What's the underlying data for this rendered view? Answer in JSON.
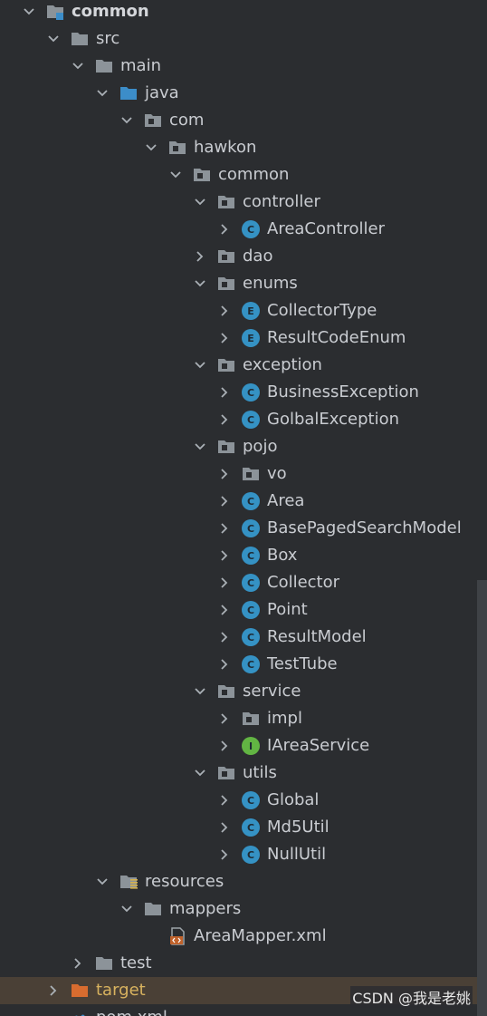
{
  "tree": [
    {
      "label": "common",
      "arrow": "down",
      "icon": "module-folder-icon",
      "bold": true
    },
    {
      "label": "src",
      "arrow": "down",
      "icon": "folder-icon"
    },
    {
      "label": "main",
      "arrow": "down",
      "icon": "folder-icon"
    },
    {
      "label": "java",
      "arrow": "down",
      "icon": "source-folder-icon"
    },
    {
      "label": "com",
      "arrow": "down",
      "icon": "package-icon"
    },
    {
      "label": "hawkon",
      "arrow": "down",
      "icon": "package-icon"
    },
    {
      "label": "common",
      "arrow": "down",
      "icon": "package-icon"
    },
    {
      "label": "controller",
      "arrow": "down",
      "icon": "package-icon"
    },
    {
      "label": "AreaController",
      "arrow": "right",
      "icon": "class-icon",
      "letter": "C"
    },
    {
      "label": "dao",
      "arrow": "right",
      "icon": "package-icon"
    },
    {
      "label": "enums",
      "arrow": "down",
      "icon": "package-icon"
    },
    {
      "label": "CollectorType",
      "arrow": "right",
      "icon": "enum-icon",
      "letter": "E"
    },
    {
      "label": "ResultCodeEnum",
      "arrow": "right",
      "icon": "enum-icon",
      "letter": "E"
    },
    {
      "label": "exception",
      "arrow": "down",
      "icon": "package-icon"
    },
    {
      "label": "BusinessException",
      "arrow": "right",
      "icon": "class-icon",
      "letter": "C"
    },
    {
      "label": "GolbalException",
      "arrow": "right",
      "icon": "class-icon",
      "letter": "C"
    },
    {
      "label": "pojo",
      "arrow": "down",
      "icon": "package-icon"
    },
    {
      "label": "vo",
      "arrow": "right",
      "icon": "package-icon"
    },
    {
      "label": "Area",
      "arrow": "right",
      "icon": "class-icon",
      "letter": "C"
    },
    {
      "label": "BasePagedSearchModel",
      "arrow": "right",
      "icon": "class-icon",
      "letter": "C"
    },
    {
      "label": "Box",
      "arrow": "right",
      "icon": "class-icon",
      "letter": "C"
    },
    {
      "label": "Collector",
      "arrow": "right",
      "icon": "class-icon",
      "letter": "C"
    },
    {
      "label": "Point",
      "arrow": "right",
      "icon": "class-icon",
      "letter": "C"
    },
    {
      "label": "ResultModel",
      "arrow": "right",
      "icon": "class-icon",
      "letter": "C"
    },
    {
      "label": "TestTube",
      "arrow": "right",
      "icon": "class-icon",
      "letter": "C"
    },
    {
      "label": "service",
      "arrow": "down",
      "icon": "package-icon"
    },
    {
      "label": "impl",
      "arrow": "right",
      "icon": "package-icon"
    },
    {
      "label": "IAreaService",
      "arrow": "right",
      "icon": "interface-icon",
      "letter": "I"
    },
    {
      "label": "utils",
      "arrow": "down",
      "icon": "package-icon"
    },
    {
      "label": "Global",
      "arrow": "right",
      "icon": "class-icon",
      "letter": "C"
    },
    {
      "label": "Md5Util",
      "arrow": "right",
      "icon": "class-icon",
      "letter": "C"
    },
    {
      "label": "NullUtil",
      "arrow": "right",
      "icon": "class-icon",
      "letter": "C"
    },
    {
      "label": "resources",
      "arrow": "down",
      "icon": "resources-folder-icon"
    },
    {
      "label": "mappers",
      "arrow": "down",
      "icon": "folder-icon"
    },
    {
      "label": "AreaMapper.xml",
      "arrow": "none",
      "icon": "xml-file-icon"
    },
    {
      "label": "test",
      "arrow": "right",
      "icon": "folder-icon"
    },
    {
      "label": "target",
      "arrow": "right",
      "icon": "excluded-folder-icon",
      "selected": true,
      "target": true
    },
    {
      "label": "pom.xml",
      "arrow": "none",
      "icon": "maven-file-icon"
    }
  ],
  "watermark": "CSDN @我是老姚",
  "colors": {
    "background": "#2b2d30",
    "text": "#c9ccd1",
    "class_icon": "#3592c4",
    "interface_icon": "#62b543",
    "folder": "#8c9399",
    "source_folder": "#3c8dc9",
    "excluded_folder": "#d86c2f",
    "selected_row": "#4a4036"
  }
}
